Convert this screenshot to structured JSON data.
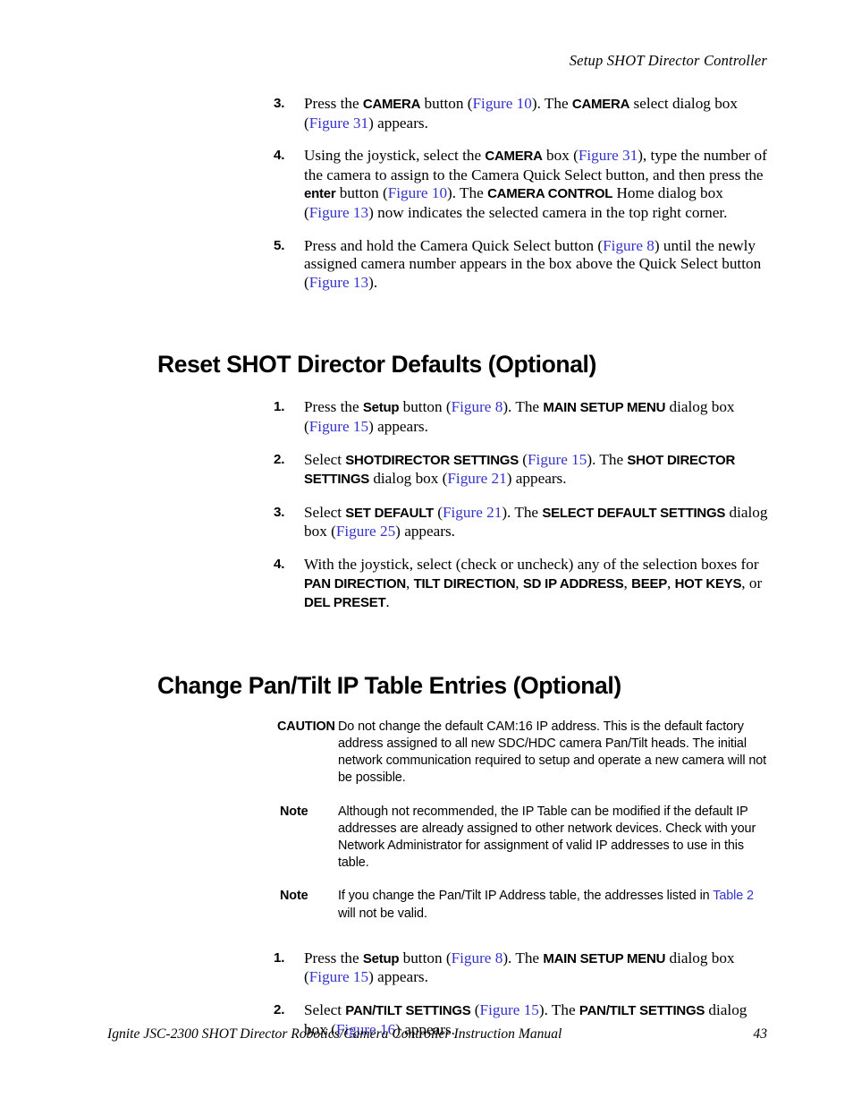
{
  "header": {
    "running_head": "Setup SHOT Director Controller"
  },
  "footer": {
    "manual_title": "Ignite JSC-2300 SHOT Director Robotics/Camera Controller Instruction Manual",
    "page_number": "43"
  },
  "colors": {
    "link": "#3333CC",
    "text": "#000000",
    "page_background": "#FFFFFF"
  },
  "top_list": {
    "items": [
      {
        "number": "3.",
        "runs": [
          {
            "t": "Press the ",
            "s": "r"
          },
          {
            "t": "CAMERA",
            "s": "b"
          },
          {
            "t": " button (",
            "s": "r"
          },
          {
            "t": "Figure 10",
            "s": "l"
          },
          {
            "t": "). The ",
            "s": "r"
          },
          {
            "t": "CAMERA",
            "s": "b"
          },
          {
            "t": " select dialog box (",
            "s": "r"
          },
          {
            "t": "Figure 31",
            "s": "l"
          },
          {
            "t": ") appears.",
            "s": "r"
          }
        ]
      },
      {
        "number": "4.",
        "runs": [
          {
            "t": "Using the joystick, select the ",
            "s": "r"
          },
          {
            "t": "CAMERA",
            "s": "b"
          },
          {
            "t": " box (",
            "s": "r"
          },
          {
            "t": "Figure 31",
            "s": "l"
          },
          {
            "t": "), type the number of the camera to assign to the Camera Quick Select button, and then press the ",
            "s": "r"
          },
          {
            "t": "enter",
            "s": "b"
          },
          {
            "t": " button (",
            "s": "r"
          },
          {
            "t": "Figure 10",
            "s": "l"
          },
          {
            "t": "). The ",
            "s": "r"
          },
          {
            "t": "CAMERA CONTROL",
            "s": "b"
          },
          {
            "t": " Home dialog box (",
            "s": "r"
          },
          {
            "t": "Figure 13",
            "s": "l"
          },
          {
            "t": ") now indicates the selected camera in the top right corner.",
            "s": "r"
          }
        ]
      },
      {
        "number": "5.",
        "runs": [
          {
            "t": "Press and hold the Camera Quick Select button (",
            "s": "r"
          },
          {
            "t": "Figure 8",
            "s": "l"
          },
          {
            "t": ") until the newly assigned camera number appears in the box above the Quick Select button (",
            "s": "r"
          },
          {
            "t": "Figure 13",
            "s": "l"
          },
          {
            "t": ").",
            "s": "r"
          }
        ]
      }
    ]
  },
  "section_reset": {
    "heading": "Reset SHOT Director Defaults (Optional)",
    "items": [
      {
        "number": "1.",
        "runs": [
          {
            "t": "Press the ",
            "s": "r"
          },
          {
            "t": "Setup",
            "s": "b"
          },
          {
            "t": " button (",
            "s": "r"
          },
          {
            "t": "Figure 8",
            "s": "l"
          },
          {
            "t": "). The ",
            "s": "r"
          },
          {
            "t": "MAIN SETUP MENU",
            "s": "b"
          },
          {
            "t": " dialog box (",
            "s": "r"
          },
          {
            "t": "Figure 15",
            "s": "l"
          },
          {
            "t": ") appears.",
            "s": "r"
          }
        ]
      },
      {
        "number": "2.",
        "runs": [
          {
            "t": "Select ",
            "s": "r"
          },
          {
            "t": "SHOTDIRECTOR SETTINGS",
            "s": "b"
          },
          {
            "t": " (",
            "s": "r"
          },
          {
            "t": "Figure 15",
            "s": "l"
          },
          {
            "t": "). The ",
            "s": "r"
          },
          {
            "t": "SHOT DIRECTOR SETTINGS",
            "s": "b"
          },
          {
            "t": " dialog box (",
            "s": "r"
          },
          {
            "t": "Figure 21",
            "s": "l"
          },
          {
            "t": ") appears.",
            "s": "r"
          }
        ]
      },
      {
        "number": "3.",
        "runs": [
          {
            "t": "Select ",
            "s": "r"
          },
          {
            "t": "SET DEFAULT",
            "s": "b"
          },
          {
            "t": " (",
            "s": "r"
          },
          {
            "t": "Figure 21",
            "s": "l"
          },
          {
            "t": "). The ",
            "s": "r"
          },
          {
            "t": "SELECT DEFAULT SETTINGS",
            "s": "b"
          },
          {
            "t": " dialog box (",
            "s": "r"
          },
          {
            "t": "Figure 25",
            "s": "l"
          },
          {
            "t": ") appears.",
            "s": "r"
          }
        ]
      },
      {
        "number": "4.",
        "runs": [
          {
            "t": "With the joystick, select (check or uncheck) any of the selection boxes for ",
            "s": "r"
          },
          {
            "t": "PAN DIRECTION",
            "s": "b"
          },
          {
            "t": ", ",
            "s": "r"
          },
          {
            "t": "TILT DIRECTION",
            "s": "b"
          },
          {
            "t": ", ",
            "s": "r"
          },
          {
            "t": "SD IP ADDRESS",
            "s": "b"
          },
          {
            "t": ", ",
            "s": "r"
          },
          {
            "t": "BEEP",
            "s": "b"
          },
          {
            "t": ", ",
            "s": "r"
          },
          {
            "t": "HOT KEYS",
            "s": "b"
          },
          {
            "t": ", or ",
            "s": "r"
          },
          {
            "t": "DEL PRESET",
            "s": "b"
          },
          {
            "t": ".",
            "s": "r"
          }
        ]
      }
    ]
  },
  "section_pantilt": {
    "heading": "Change Pan/Tilt IP Table Entries (Optional)",
    "admonitions": [
      {
        "label": "CAUTION",
        "kind": "caution",
        "runs": [
          {
            "t": "Do not change the default CAM:16 IP address. This is the default factory address assigned to all new SDC/HDC camera Pan/Tilt heads. The initial network communication required to setup and operate a new camera will not be possible.",
            "s": "r"
          }
        ]
      },
      {
        "label": "Note",
        "kind": "note",
        "runs": [
          {
            "t": "Although not recommended, the IP Table can be modified if the default IP addresses are already assigned to other network devices. Check with your Network Administrator for assignment of valid IP addresses to use in this table.",
            "s": "r"
          }
        ]
      },
      {
        "label": "Note",
        "kind": "note",
        "runs": [
          {
            "t": "If you change the Pan/Tilt IP Address table, the addresses listed in ",
            "s": "r"
          },
          {
            "t": "Table 2",
            "s": "l"
          },
          {
            "t": " will not be valid.",
            "s": "r"
          }
        ]
      }
    ],
    "items": [
      {
        "number": "1.",
        "runs": [
          {
            "t": "Press the ",
            "s": "r"
          },
          {
            "t": "Setup",
            "s": "b"
          },
          {
            "t": " button (",
            "s": "r"
          },
          {
            "t": "Figure 8",
            "s": "l"
          },
          {
            "t": "). The ",
            "s": "r"
          },
          {
            "t": "MAIN SETUP MENU",
            "s": "b"
          },
          {
            "t": " dialog box (",
            "s": "r"
          },
          {
            "t": "Figure 15",
            "s": "l"
          },
          {
            "t": ") appears.",
            "s": "r"
          }
        ]
      },
      {
        "number": "2.",
        "runs": [
          {
            "t": "Select ",
            "s": "r"
          },
          {
            "t": "PAN/TILT SETTINGS",
            "s": "b"
          },
          {
            "t": " (",
            "s": "r"
          },
          {
            "t": "Figure 15",
            "s": "l"
          },
          {
            "t": "). The ",
            "s": "r"
          },
          {
            "t": "PAN/TILT SETTINGS",
            "s": "b"
          },
          {
            "t": " dialog box (",
            "s": "r"
          },
          {
            "t": "Figure 16",
            "s": "l"
          },
          {
            "t": ") appears.",
            "s": "r"
          }
        ]
      }
    ]
  }
}
